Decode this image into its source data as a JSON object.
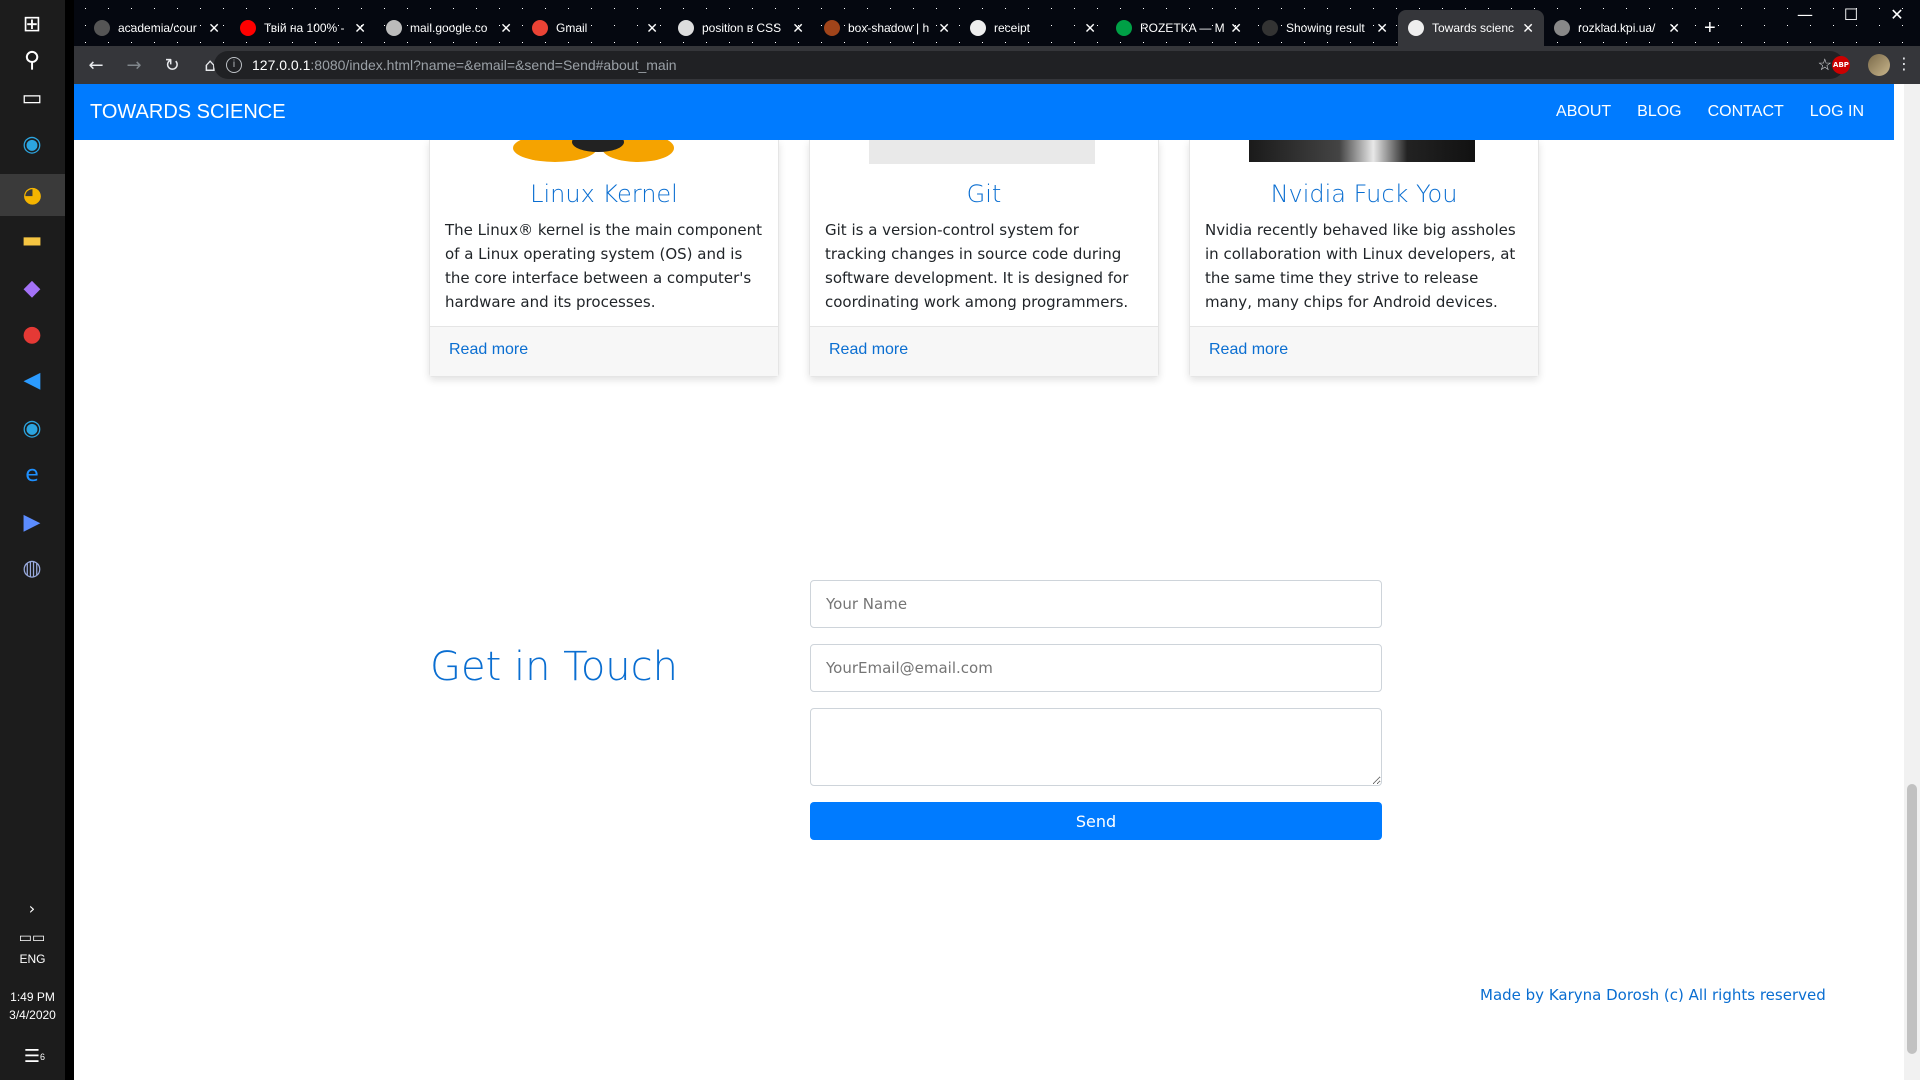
{
  "taskbar": {
    "language": "ENG",
    "time": "1:49 PM",
    "date": "3/4/2020",
    "notification_count": "6"
  },
  "tabs": [
    {
      "title": "academia/cour",
      "favicon_color": "#555555"
    },
    {
      "title": "Твій на 100% -",
      "favicon_color": "#ff0000"
    },
    {
      "title": "mail.google.co",
      "favicon_color": "#bbbbbb"
    },
    {
      "title": "Gmail",
      "favicon_color": "#ea4335"
    },
    {
      "title": "position в CSS",
      "favicon_color": "#dddddd"
    },
    {
      "title": "box-shadow | h",
      "favicon_color": "#a0441a"
    },
    {
      "title": "receipt",
      "favicon_color": "#eeeeee"
    },
    {
      "title": "ROZETKA — M",
      "favicon_color": "#00a046"
    },
    {
      "title": "Showing result",
      "favicon_color": "#333333"
    },
    {
      "title": "Towards scienc",
      "favicon_color": "#eeeeee"
    },
    {
      "title": "rozklad.kpi.ua/",
      "favicon_color": "#888888"
    }
  ],
  "address": {
    "host": "127.0.0.1",
    "path": ":8080/index.html?name=&email=&send=Send#about_main"
  },
  "navbar": {
    "brand": "TOWARDS SCIENCE",
    "links": [
      "ABOUT",
      "BLOG",
      "CONTACT",
      "LOG IN"
    ]
  },
  "cards": [
    {
      "title": "Linux Kernel",
      "text": "The Linux® kernel is the main component of a Linux operating system (OS) and is the core interface between a computer's hardware and its processes.",
      "link": "Read more"
    },
    {
      "title": "Git",
      "text": "Git is a version-control system for tracking changes in source code during software development. It is designed for coordinating work among programmers.",
      "link": "Read more"
    },
    {
      "title": "Nvidia Fuck You",
      "text": "Nvidia recently behaved like big assholes in collaboration with Linux developers, at the same time they strive to release many, many chips for Android devices.",
      "link": "Read more"
    }
  ],
  "contact": {
    "heading": "Get in Touch",
    "name_placeholder": "Your Name",
    "email_placeholder": "YourEmail@email.com",
    "message_placeholder": "",
    "send_label": "Send"
  },
  "footer": {
    "text": "Made by Karyna Dorosh (c) All rights reserved"
  },
  "colors": {
    "primary": "#007bff",
    "link": "#0a6ed1"
  }
}
